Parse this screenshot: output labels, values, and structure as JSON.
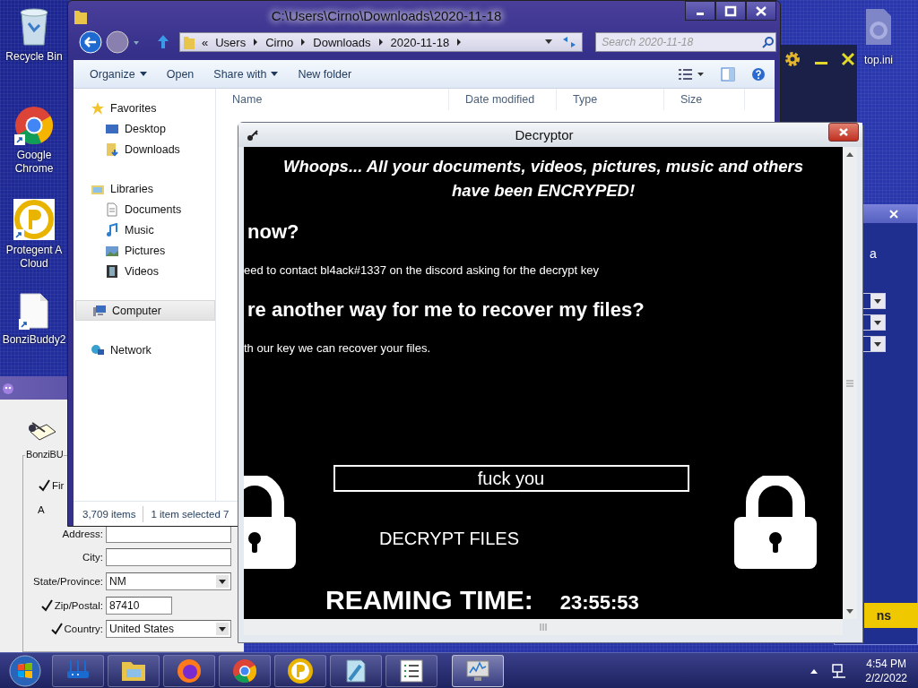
{
  "desktop": {
    "icons": [
      {
        "kind": "recycle",
        "lines": [
          "Recycle Bin"
        ]
      },
      {
        "kind": "chrome",
        "lines": [
          "Google",
          "Chrome"
        ]
      },
      {
        "kind": "protegent",
        "lines": [
          "Protegent A",
          "Cloud"
        ]
      },
      {
        "kind": "file",
        "lines": [
          "BonziBuddy2"
        ]
      }
    ],
    "right_icon": {
      "kind": "settings-file",
      "lines": [
        "top.ini"
      ]
    }
  },
  "bonzi_window": {
    "group_label": "BonziBU",
    "rows": [
      {
        "label": "Fir",
        "checked": true,
        "kind": "cut"
      },
      {
        "label": "A",
        "checked": false,
        "kind": "cut"
      },
      {
        "label": "Address:",
        "checked": false,
        "kind": "text"
      },
      {
        "label": "City:",
        "checked": false,
        "kind": "text"
      },
      {
        "label": "State/Province:",
        "checked": false,
        "kind": "select",
        "value": "NM"
      },
      {
        "label": "Zip/Postal:",
        "checked": true,
        "kind": "short",
        "value": "87410"
      },
      {
        "label": "Country:",
        "checked": true,
        "kind": "select",
        "value": "United States"
      }
    ]
  },
  "explorer": {
    "title": "C:\\Users\\Cirno\\Downloads\\2020-11-18",
    "breadcrumb": [
      "«",
      "Users",
      "Cirno",
      "Downloads",
      "2020-11-18"
    ],
    "search": {
      "placeholder": "Search 2020-11-18"
    },
    "toolbar": [
      {
        "label": "Organize",
        "dropdown": true
      },
      {
        "label": "Open",
        "dropdown": false
      },
      {
        "label": "Share with",
        "dropdown": true
      },
      {
        "label": "New folder",
        "dropdown": false
      }
    ],
    "sidebar": [
      {
        "label": "Favorites",
        "kind": "star",
        "selected": false,
        "children": [
          {
            "label": "Desktop",
            "kind": "desktop",
            "selected": false
          },
          {
            "label": "Downloads",
            "kind": "downloads",
            "selected": false
          }
        ]
      },
      {
        "label": "Libraries",
        "kind": "library",
        "selected": false,
        "children": [
          {
            "label": "Documents",
            "kind": "document",
            "selected": false
          },
          {
            "label": "Music",
            "kind": "music",
            "selected": false
          },
          {
            "label": "Pictures",
            "kind": "pictures",
            "selected": false
          },
          {
            "label": "Videos",
            "kind": "videos",
            "selected": false
          }
        ]
      },
      {
        "label": "Computer",
        "kind": "computer",
        "selected": true
      },
      {
        "label": "Network",
        "kind": "network",
        "selected": false
      }
    ],
    "columns": [
      "Name",
      "Date modified",
      "Type",
      "Size"
    ],
    "status": [
      "3,709 items",
      "1 item selected 7"
    ]
  },
  "side_window": {
    "text": "a",
    "button": "ns"
  },
  "decryptor": {
    "title": "Decryptor",
    "headline": [
      "Whoops... All your documents, videos, pictures, music and others",
      "have been ENCRYPED!"
    ],
    "sections": [
      {
        "kind": "heading",
        "text": "now?"
      },
      {
        "kind": "paragraph",
        "text": "eed to contact bl4ack#1337 on the discord asking for the decrypt key"
      },
      {
        "kind": "heading",
        "text": "re another way for me to recover my files?"
      },
      {
        "kind": "paragraph",
        "text": "th our key we can recover your files."
      }
    ],
    "key_value": "fuck you",
    "button": "DECRYPT FILES",
    "timer_label": "REAMING TIME:",
    "timer": "23:55:53"
  },
  "taskbar": {
    "items": [
      {
        "kind": "router",
        "selected": false
      },
      {
        "kind": "folder",
        "selected": false
      },
      {
        "kind": "firefox",
        "selected": false
      },
      {
        "kind": "chrome",
        "selected": false
      },
      {
        "kind": "protegent",
        "selected": false
      },
      {
        "kind": "notepad",
        "selected": false
      },
      {
        "kind": "list",
        "selected": false
      },
      {
        "kind": "monitor",
        "selected": true
      }
    ],
    "clock": {
      "time": "4:54 PM",
      "date": "2/2/2022"
    }
  }
}
